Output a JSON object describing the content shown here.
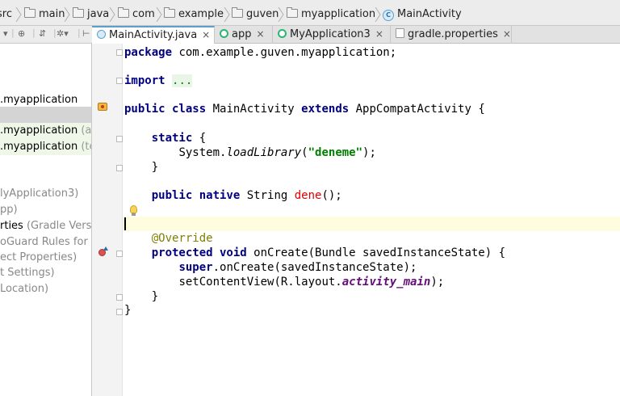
{
  "breadcrumb": {
    "items": [
      {
        "label": "src",
        "icon": "folder-icon"
      },
      {
        "label": "main",
        "icon": "folder-icon"
      },
      {
        "label": "java",
        "icon": "folder-icon"
      },
      {
        "label": "com",
        "icon": "folder-icon"
      },
      {
        "label": "example",
        "icon": "folder-icon"
      },
      {
        "label": "guven",
        "icon": "folder-icon"
      },
      {
        "label": "myapplication",
        "icon": "folder-icon"
      },
      {
        "label": "MainActivity",
        "icon": "class-icon"
      }
    ]
  },
  "tabs": [
    {
      "label": "MainActivity.java",
      "active": true,
      "close": "×"
    },
    {
      "label": "app",
      "close": "×"
    },
    {
      "label": "MyApplication3",
      "close": "×"
    },
    {
      "label": "gradle.properties",
      "close": "×"
    }
  ],
  "sidebar": {
    "items": [
      {
        "main": ".myapplication",
        "secondary": ""
      },
      {
        "main": ".myapplication",
        "secondary": " (ar"
      },
      {
        "main": ".myapplication",
        "secondary": " (te"
      },
      {
        "main": "",
        "secondary": "lyApplication3)"
      },
      {
        "main": "",
        "secondary": "pp)"
      },
      {
        "main": "rties",
        "secondary": " (Gradle Versio"
      },
      {
        "main": "",
        "secondary": "oGuard Rules for a"
      },
      {
        "main": "",
        "secondary": "ect Properties)"
      },
      {
        "main": "",
        "secondary": "t Settings)"
      },
      {
        "main": "",
        "secondary": "Location)"
      }
    ]
  },
  "code": {
    "l1_kw": "package",
    "l1_rest": " com.example.guven.myapplication;",
    "l2_kw": "import",
    "l2_fold": "...",
    "l3_kw1": "public class",
    "l3_name": " MainActivity ",
    "l3_kw2": "extends",
    "l3_rest": " AppCompatActivity {",
    "l4_kw": "static",
    "l4_rest": " {",
    "l5_a": "System.",
    "l5_method": "loadLibrary",
    "l5_b": "(",
    "l5_str": "\"deneme\"",
    "l5_c": ");",
    "l6": "}",
    "l7_kw": "public native",
    "l7_a": " String ",
    "l7_red": "dene",
    "l7_b": "();",
    "l8_ann": "@Override",
    "l9_kw": "protected void",
    "l9_rest": " onCreate(Bundle savedInstanceState) {",
    "l10_kw": "super",
    "l10_rest": ".onCreate(savedInstanceState);",
    "l11_a": "setContentView(R.layout.",
    "l11_fld": "activity_main",
    "l11_b": ");",
    "l12": "}",
    "l13": "}"
  }
}
